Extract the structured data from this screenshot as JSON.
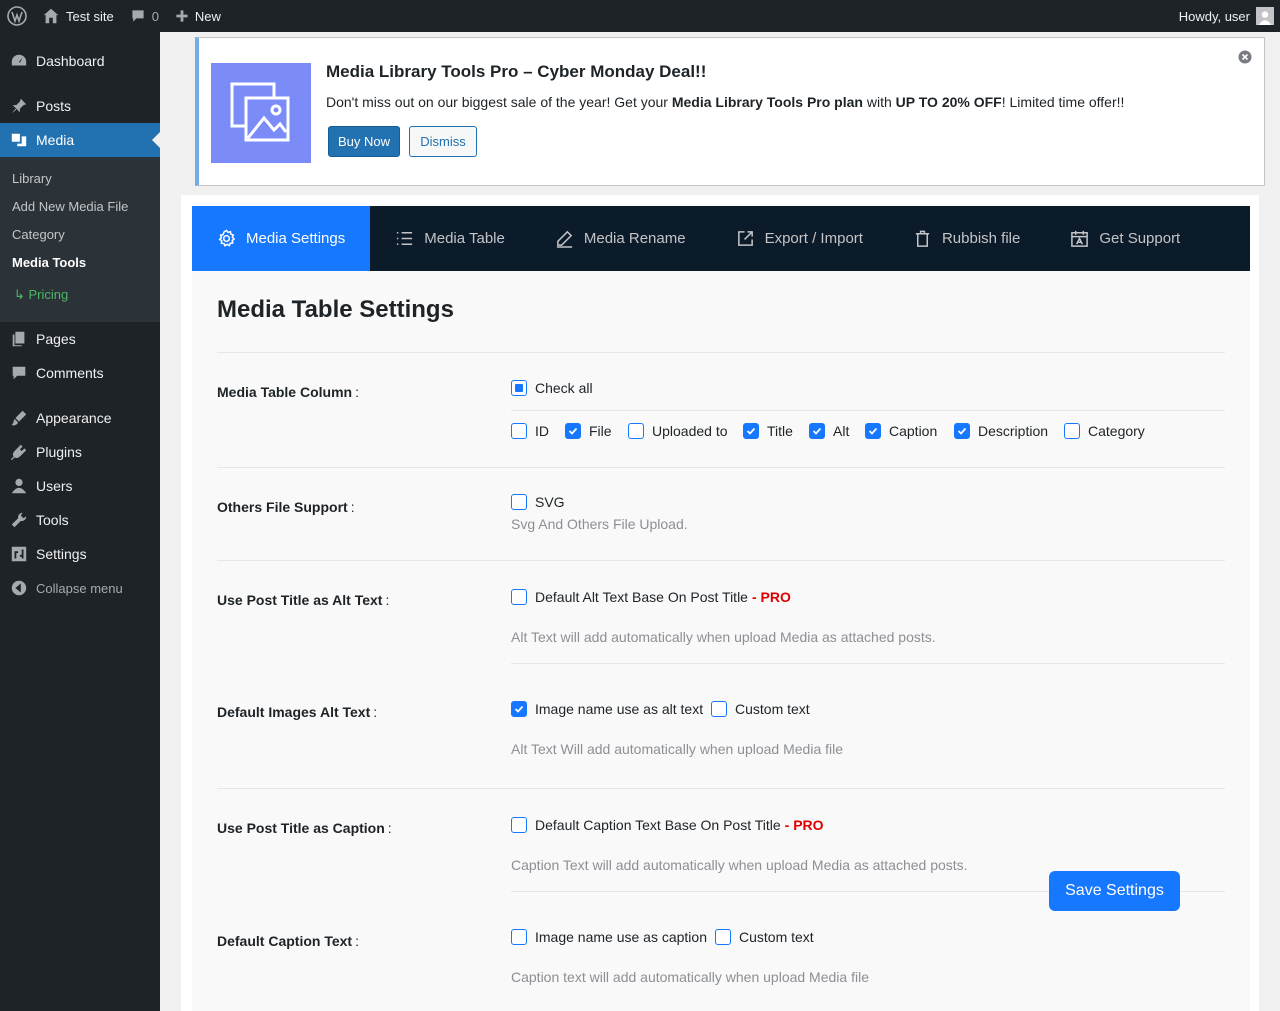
{
  "adminbar": {
    "site_name": "Test site",
    "comments_count": "0",
    "new_label": "New",
    "howdy": "Howdy, user"
  },
  "sidebar": {
    "items": [
      {
        "label": "Dashboard",
        "icon": "dashboard-icon"
      },
      {
        "label": "Posts",
        "icon": "pin-icon"
      },
      {
        "label": "Media",
        "icon": "media-icon"
      },
      {
        "label": "Pages",
        "icon": "pages-icon"
      },
      {
        "label": "Comments",
        "icon": "comment-icon"
      },
      {
        "label": "Appearance",
        "icon": "brush-icon"
      },
      {
        "label": "Plugins",
        "icon": "plugin-icon"
      },
      {
        "label": "Users",
        "icon": "user-icon"
      },
      {
        "label": "Tools",
        "icon": "wrench-icon"
      },
      {
        "label": "Settings",
        "icon": "settings-icon"
      }
    ],
    "submenu": [
      "Library",
      "Add New Media File",
      "Category",
      "Media Tools"
    ],
    "pricing": "↳ Pricing",
    "collapse": "Collapse menu"
  },
  "notice": {
    "title": "Media Library Tools Pro – Cyber Monday Deal!!",
    "text_1": "Don't miss out on our biggest sale of the year! Get your ",
    "text_bold_1": "Media Library Tools Pro plan",
    "text_2": " with ",
    "text_bold_2": "UP TO 20% OFF",
    "text_3": "! Limited time offer!!",
    "buy_label": "Buy Now",
    "dismiss_label": "Dismiss"
  },
  "tabs": [
    {
      "label": "Media Settings",
      "icon": "gear-icon",
      "active": true
    },
    {
      "label": "Media Table",
      "icon": "list-icon"
    },
    {
      "label": "Media Rename",
      "icon": "pencil-icon"
    },
    {
      "label": "Export / Import",
      "icon": "external-link-icon"
    },
    {
      "label": "Rubbish file",
      "icon": "trash-icon"
    },
    {
      "label": "Get Support",
      "icon": "support-icon"
    }
  ],
  "page_title": "Media Table Settings",
  "colon": ":",
  "pro": "- PRO",
  "sections": {
    "columns": {
      "label": "Media Table Column",
      "check_all": "Check all",
      "options": [
        {
          "label": "ID",
          "checked": false
        },
        {
          "label": "File",
          "checked": true
        },
        {
          "label": "Uploaded to",
          "checked": false
        },
        {
          "label": "Title",
          "checked": true
        },
        {
          "label": "Alt",
          "checked": true
        },
        {
          "label": "Caption",
          "checked": true
        },
        {
          "label": "Description",
          "checked": true
        },
        {
          "label": "Category",
          "checked": false
        }
      ]
    },
    "file_support": {
      "label": "Others File Support",
      "option": "SVG",
      "desc": "Svg And Others File Upload."
    },
    "post_title_alt": {
      "label": "Use Post Title as Alt Text",
      "option": "Default Alt Text Base On Post Title",
      "desc": "Alt Text will add automatically when upload Media as attached posts."
    },
    "default_alt": {
      "label": "Default Images Alt Text",
      "option_1": "Image name use as alt text",
      "option_2": "Custom text",
      "desc": "Alt Text Will add automatically when upload Media file"
    },
    "post_title_caption": {
      "label": "Use Post Title as Caption",
      "option": "Default Caption Text Base On Post Title",
      "desc": "Caption Text will add automatically when upload Media as attached posts."
    },
    "default_caption": {
      "label": "Default Caption Text",
      "option_1": "Image name use as caption",
      "option_2": "Custom text",
      "desc": "Caption text will add automatically when upload Media file"
    }
  },
  "save_label": "Save Settings",
  "colors": {
    "accent": "#1677ff",
    "wp_blue": "#2271b1",
    "pro_red": "#e00000",
    "pricing_green": "#4ab866"
  }
}
